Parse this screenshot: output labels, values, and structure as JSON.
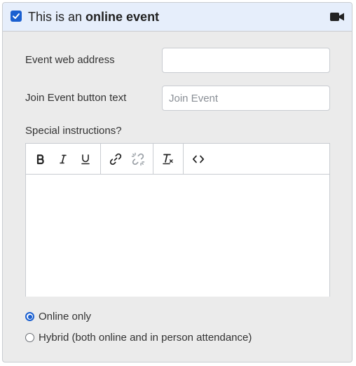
{
  "header": {
    "checkbox_checked": true,
    "title_prefix": "This is an ",
    "title_bold": "online event",
    "icon": "video-camera-icon"
  },
  "fields": {
    "web_address": {
      "label": "Event web address",
      "value": "",
      "placeholder": ""
    },
    "join_button_text": {
      "label": "Join Event button text",
      "value": "",
      "placeholder": "Join Event"
    }
  },
  "instructions": {
    "label": "Special instructions?",
    "toolbar": [
      {
        "name": "bold",
        "icon": "bold-icon",
        "glyph": "B"
      },
      {
        "name": "italic",
        "icon": "italic-icon",
        "glyph": "I"
      },
      {
        "name": "underline",
        "icon": "underline-icon",
        "glyph": "U"
      },
      {
        "name": "link",
        "icon": "link-icon"
      },
      {
        "name": "unlink",
        "icon": "unlink-icon"
      },
      {
        "name": "clear-formatting",
        "icon": "clear-formatting-icon",
        "glyph": "T"
      },
      {
        "name": "code",
        "icon": "code-icon",
        "glyph": "<>"
      }
    ],
    "content": ""
  },
  "attendance": {
    "options": [
      {
        "label": "Online only",
        "selected": true
      },
      {
        "label": "Hybrid (both online and in person attendance)",
        "selected": false
      }
    ]
  },
  "colors": {
    "accent": "#1a5fd0",
    "header_bg": "#e6eefb",
    "panel_bg": "#ebebeb",
    "border": "#c9ccd1"
  }
}
